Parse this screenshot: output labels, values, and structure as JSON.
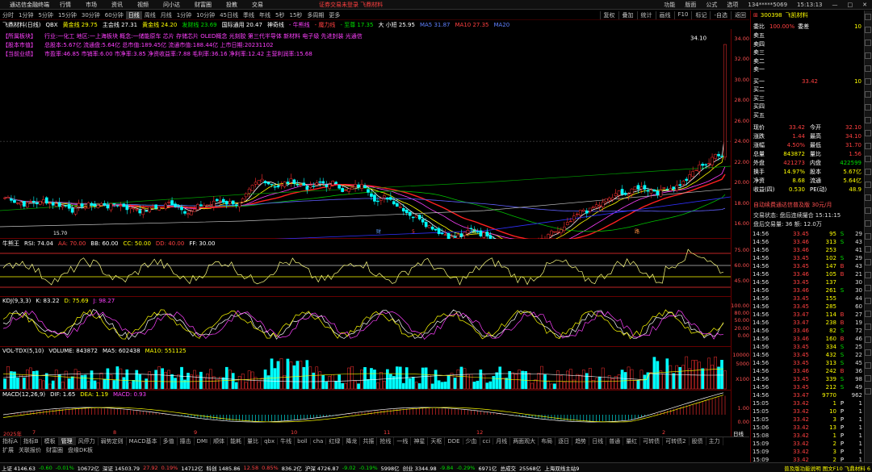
{
  "menu": {
    "app_title": "通达信金融终端",
    "items": [
      "行情",
      "市场",
      "资讯",
      "视频",
      "问小达",
      "财富圈",
      "投教",
      "交易"
    ],
    "promo": "证券交易未登录  飞鼎材料",
    "right": [
      "功能",
      "版面",
      "公式",
      "选项"
    ],
    "account": "134*****5069",
    "clock": "15:13:13"
  },
  "periods": [
    "分时",
    "1分钟",
    "5分钟",
    "15分钟",
    "30分钟",
    "60分钟",
    "日线",
    "周线",
    "月线",
    "1分钟",
    "10分钟",
    "45日线",
    "季线",
    "年线",
    "5秒",
    "15秒",
    "多周期",
    "更多"
  ],
  "selected_period": "日线",
  "toolbar_right": [
    "复权",
    "叠加",
    "统计",
    "画线",
    "F10",
    "标记",
    "-自选",
    "返回"
  ],
  "title_row": {
    "name": "飞鼎材料(日线)",
    "ind": "QBX",
    "items": [
      {
        "t": "黄金线 29.75",
        "c": "yel"
      },
      {
        "t": "主会线 27.31",
        "c": "wht"
      },
      {
        "t": "黄金线 24.20",
        "c": "yel"
      },
      {
        "t": "发财线 23.69",
        "c": "grn"
      },
      {
        "t": "国际通用 20.47",
        "c": "wht"
      },
      {
        "t": "神奇线",
        "c": "wht"
      },
      {
        "t": "- 牛熊线",
        "c": "mag"
      },
      {
        "t": "- 魔力线",
        "c": "red"
      },
      {
        "t": "- 至尊 17.35",
        "c": "grn"
      },
      {
        "t": "大 小短 25.95",
        "c": "wht"
      },
      {
        "t": "MA5 31.87",
        "c": "blu"
      },
      {
        "t": "MA10 27.35",
        "c": "red"
      },
      {
        "t": "MA20",
        "c": "blu"
      }
    ]
  },
  "info_lines": [
    {
      "label": "【所属板块】",
      "text": "行业:一化工   地区:一上海板块   概念:一储能原车 芯片 存储芯片 OLED概念 光刻胶 第三代半导体 新材料 电子级 先进封装 光通信"
    },
    {
      "label": "【股本市值】",
      "text": "总股本:5.67亿   流通盘:5.64亿   总市值:189.45亿   流通市值:188.44亿   上市日期:20231102"
    },
    {
      "label": "【当前业绩】",
      "text": "市盈率:46.85   市销率:6.00   市净率:3.85   净资收益率:7.88   毛利率:36.16   净利率:12.42   主营利润率:15.68"
    }
  ],
  "price_labels": {
    "high": "34.10",
    "low": "15.70"
  },
  "price_axis": [
    "34.00",
    "32.00",
    "30.00",
    "28.00",
    "26.00",
    "24.00",
    "22.00",
    "20.00",
    "18.00",
    "16.00"
  ],
  "event_markers": [
    "财",
    "5",
    "诚",
    "路"
  ],
  "rsi": {
    "name": "牛熊王",
    "vals": [
      {
        "t": "RSI: 74.04",
        "c": "wht"
      },
      {
        "t": "AA: 70.00",
        "c": "red"
      },
      {
        "t": "BB: 60.00",
        "c": "wht"
      },
      {
        "t": "CC: 50.00",
        "c": "yel"
      },
      {
        "t": "DD: 40.00",
        "c": "red"
      },
      {
        "t": "FF: 30.00",
        "c": "wht"
      }
    ],
    "axis": [
      "75.00",
      "60.00",
      "45.00"
    ]
  },
  "kdj": {
    "name": "KDJ(9,3,3)",
    "vals": [
      {
        "t": "K: 83.22",
        "c": "wht"
      },
      {
        "t": "D: 75.69",
        "c": "yel"
      },
      {
        "t": "J: 98.27",
        "c": "mag"
      }
    ],
    "axis": [
      "100.00",
      "80.00",
      "50.00",
      "20.00",
      "0.00"
    ]
  },
  "vol": {
    "name": "VOL-TDX(5,10)",
    "vals": [
      {
        "t": "VOLUME: 843872",
        "c": "wht"
      },
      {
        "t": "MA5: 602438",
        "c": "wht"
      },
      {
        "t": "MA10: 551125",
        "c": "yel"
      }
    ],
    "axis": [
      "10000",
      "5000",
      "X100"
    ]
  },
  "macd": {
    "name": "MACD(12,26,9)",
    "vals": [
      {
        "t": "DIF: 1.65",
        "c": "wht"
      },
      {
        "t": "DEA: 1.19",
        "c": "yel"
      },
      {
        "t": "MACD: 0.93",
        "c": "mag"
      }
    ],
    "axis": [
      "1.00",
      "0.00"
    ]
  },
  "xaxis": [
    "2025年",
    "7",
    "8",
    "9",
    "10",
    "11",
    "12",
    "2"
  ],
  "xaxis_right": "日线",
  "tabs": [
    "指标A",
    "指标B",
    "模板",
    "管理",
    "风停力",
    "弱势定则",
    "MACD基本",
    "多值",
    "撞击",
    "DMI",
    "顺体",
    "能耗",
    "量比",
    "qbx",
    "牛线",
    "boll",
    "cha",
    "红绿",
    "降龙",
    "共振",
    "抢线",
    "一线",
    "神星",
    "天枢",
    "DDE",
    "少血",
    "cci",
    "月线",
    "两面观大",
    "布局",
    "逐日",
    "趋势",
    "日线",
    "普通",
    "量红",
    "可转债",
    "可转债2",
    "股债",
    "主力"
  ],
  "selected_tab": "管理",
  "tabs2": [
    "扩展",
    "关联报价",
    "财富圈",
    "盘缘DK板"
  ],
  "status": [
    {
      "t": "上证 4146.63",
      "c": "wht"
    },
    {
      "t": "-0.60",
      "c": "grn"
    },
    {
      "t": "-0.01%",
      "c": "grn"
    },
    {
      "t": "10672亿",
      "c": "wht"
    },
    {
      "t": "深证 14503.79",
      "c": "wht"
    },
    {
      "t": "27.92",
      "c": "red"
    },
    {
      "t": "0.19%",
      "c": "red"
    },
    {
      "t": "14712亿",
      "c": "wht"
    },
    {
      "t": "科创 1485.86",
      "c": "wht"
    },
    {
      "t": "12.58",
      "c": "red"
    },
    {
      "t": "0.85%",
      "c": "red"
    },
    {
      "t": "836.2亿",
      "c": "wht"
    },
    {
      "t": "沪深 4726.87",
      "c": "wht"
    },
    {
      "t": "-9.02",
      "c": "grn"
    },
    {
      "t": "-0.19%",
      "c": "grn"
    },
    {
      "t": "5998亿",
      "c": "wht"
    },
    {
      "t": "创业 3344.98",
      "c": "wht"
    },
    {
      "t": "-9.84",
      "c": "grn"
    },
    {
      "t": "-0.29%",
      "c": "grn"
    },
    {
      "t": "6971亿",
      "c": "wht"
    },
    {
      "t": "总成交",
      "c": "wht"
    },
    {
      "t": "25568亿",
      "c": "wht"
    },
    {
      "t": "上海双线主站9",
      "c": "wht"
    }
  ],
  "status_right": "普及版功能说明  图文F10  飞鼎材料  6",
  "quote": {
    "code": "300398",
    "name": "飞凯材料",
    "weibi": "委比",
    "weibi_val": "100.00%",
    "weicha": "委差",
    "weicha_val": "10",
    "sells": [
      {
        "l": "卖五",
        "p": "",
        "v": ""
      },
      {
        "l": "卖四",
        "p": "",
        "v": ""
      },
      {
        "l": "卖三",
        "p": "",
        "v": ""
      },
      {
        "l": "卖二",
        "p": "",
        "v": ""
      },
      {
        "l": "卖一",
        "p": "",
        "v": ""
      }
    ],
    "buys": [
      {
        "l": "买一",
        "p": "33.42",
        "v": "10"
      },
      {
        "l": "买二",
        "p": "",
        "v": ""
      },
      {
        "l": "买三",
        "p": "",
        "v": ""
      },
      {
        "l": "买四",
        "p": "",
        "v": ""
      },
      {
        "l": "买五",
        "p": "",
        "v": ""
      }
    ],
    "stats": [
      [
        {
          "t": "现价",
          "c": "wht"
        },
        {
          "t": "33.42",
          "c": "red"
        },
        {
          "t": "今开",
          "c": "wht"
        },
        {
          "t": "32.10",
          "c": "red"
        }
      ],
      [
        {
          "t": "涨跌",
          "c": "wht"
        },
        {
          "t": "1.44",
          "c": "red"
        },
        {
          "t": "最高",
          "c": "wht"
        },
        {
          "t": "34.10",
          "c": "red"
        }
      ],
      [
        {
          "t": "涨幅",
          "c": "wht"
        },
        {
          "t": "4.50%",
          "c": "red"
        },
        {
          "t": "最低",
          "c": "wht"
        },
        {
          "t": "31.70",
          "c": "red"
        }
      ],
      [
        {
          "t": "总量",
          "c": "wht"
        },
        {
          "t": "843872",
          "c": "yel"
        },
        {
          "t": "量比",
          "c": "wht"
        },
        {
          "t": "1.56",
          "c": "red"
        }
      ],
      [
        {
          "t": "外盘",
          "c": "wht"
        },
        {
          "t": "421273",
          "c": "red"
        },
        {
          "t": "内盘",
          "c": "wht"
        },
        {
          "t": "422599",
          "c": "grn"
        }
      ],
      [
        {
          "t": "换手",
          "c": "wht"
        },
        {
          "t": "14.97%",
          "c": "yel"
        },
        {
          "t": "股本",
          "c": "wht"
        },
        {
          "t": "5.67亿",
          "c": "yel"
        }
      ],
      [
        {
          "t": "净资",
          "c": "wht"
        },
        {
          "t": "8.68",
          "c": "yel"
        },
        {
          "t": "流通",
          "c": "wht"
        },
        {
          "t": "5.64亿",
          "c": "yel"
        }
      ],
      [
        {
          "t": "收益(四)",
          "c": "wht"
        },
        {
          "t": "0.530",
          "c": "yel"
        },
        {
          "t": "PE(动)",
          "c": "wht"
        },
        {
          "t": "48.9",
          "c": "yel"
        }
      ]
    ],
    "promo": "自动续费通达信普及版 30元/月",
    "trade_status": "交易状态: 盘后连续撮合 15:11:15",
    "after_hours": "盘后交易量: 36   额: 12.0万"
  },
  "ticks": [
    {
      "t": "14:56",
      "p": "33.45",
      "v": "95",
      "d": "S",
      "n": "29"
    },
    {
      "t": "14:56",
      "p": "33.46",
      "v": "313",
      "d": "S",
      "n": "43"
    },
    {
      "t": "14:56",
      "p": "33.46",
      "v": "253",
      "d": "",
      "n": "41"
    },
    {
      "t": "14:56",
      "p": "33.45",
      "v": "102",
      "d": "S",
      "n": "29"
    },
    {
      "t": "14:56",
      "p": "33.45",
      "v": "147",
      "d": "B",
      "n": "43"
    },
    {
      "t": "14:56",
      "p": "33.46",
      "v": "105",
      "d": "B",
      "n": "21"
    },
    {
      "t": "14:56",
      "p": "33.45",
      "v": "137",
      "d": "",
      "n": "30"
    },
    {
      "t": "14:56",
      "p": "33.46",
      "v": "261",
      "d": "S",
      "n": "30"
    },
    {
      "t": "14:56",
      "p": "33.45",
      "v": "155",
      "d": "",
      "n": "44"
    },
    {
      "t": "14:56",
      "p": "33.45",
      "v": "285",
      "d": "",
      "n": "60"
    },
    {
      "t": "14:56",
      "p": "33.47",
      "v": "114",
      "d": "B",
      "n": "27"
    },
    {
      "t": "14:56",
      "p": "33.47",
      "v": "238",
      "d": "B",
      "n": "19"
    },
    {
      "t": "14:56",
      "p": "33.46",
      "v": "82",
      "d": "S",
      "n": "72"
    },
    {
      "t": "14:56",
      "p": "33.46",
      "v": "160",
      "d": "B",
      "n": "46"
    },
    {
      "t": "14:56",
      "p": "33.45",
      "v": "334",
      "d": "S",
      "n": "25"
    },
    {
      "t": "14:56",
      "p": "33.45",
      "v": "432",
      "d": "S",
      "n": "22"
    },
    {
      "t": "14:56",
      "p": "33.45",
      "v": "313",
      "d": "S",
      "n": "45"
    },
    {
      "t": "14:56",
      "p": "33.46",
      "v": "242",
      "d": "B",
      "n": "36"
    },
    {
      "t": "14:56",
      "p": "33.45",
      "v": "339",
      "d": "S",
      "n": "98"
    },
    {
      "t": "14:56",
      "p": "33.45",
      "v": "212",
      "d": "S",
      "n": "49"
    },
    {
      "t": "14:56",
      "p": "33.47",
      "v": "9770",
      "d": "",
      "n": "962"
    },
    {
      "t": "15:05",
      "p": "33.42",
      "v": "1",
      "d": "P",
      "n": "1"
    },
    {
      "t": "15:05",
      "p": "33.42",
      "v": "10",
      "d": "P",
      "n": "1"
    },
    {
      "t": "15:05",
      "p": "33.42",
      "v": "3",
      "d": "P",
      "n": "1"
    },
    {
      "t": "15:06",
      "p": "33.42",
      "v": "13",
      "d": "P",
      "n": "1"
    },
    {
      "t": "15:08",
      "p": "33.42",
      "v": "1",
      "d": "P",
      "n": "1"
    },
    {
      "t": "15:09",
      "p": "33.42",
      "v": "2",
      "d": "P",
      "n": "1"
    },
    {
      "t": "15:09",
      "p": "33.42",
      "v": "3",
      "d": "P",
      "n": "1"
    },
    {
      "t": "15:09",
      "p": "33.42",
      "v": "2",
      "d": "P",
      "n": "1"
    }
  ]
}
